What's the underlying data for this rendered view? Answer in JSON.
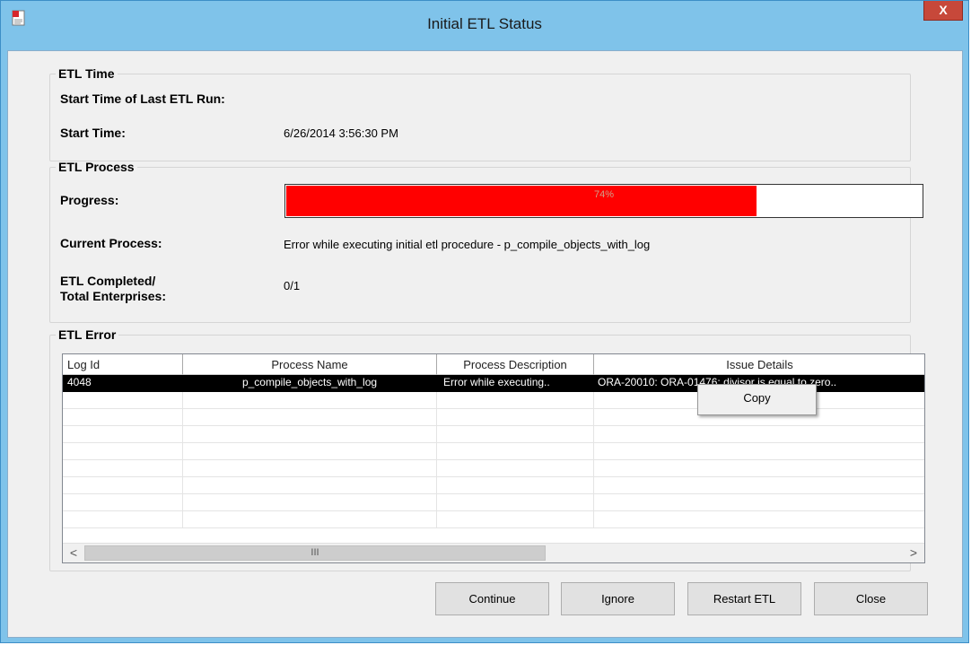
{
  "window": {
    "title": "Initial ETL Status",
    "close_label": "X"
  },
  "etl_time": {
    "legend": "ETL Time",
    "last_run_label": "Start Time of Last ETL Run:",
    "start_time_label": "Start Time:",
    "start_time_value": "6/26/2014 3:56:30 PM"
  },
  "etl_process": {
    "legend": "ETL Process",
    "progress_label": "Progress:",
    "progress_percent": 74,
    "progress_text": "74%",
    "current_process_label": "Current Process:",
    "current_process_value": "Error while executing initial etl procedure - p_compile_objects_with_log",
    "completed_label_line1": "ETL Completed/",
    "completed_label_line2": "Total Enterprises:",
    "completed_value": "0/1"
  },
  "etl_error": {
    "legend": "ETL Error",
    "columns": [
      "Log Id",
      "Process Name",
      "Process Description",
      "Issue Details"
    ],
    "rows": [
      {
        "log_id": "4048",
        "process_name": "p_compile_objects_with_log",
        "process_description": "Error while executing..",
        "issue_details": "ORA-20010: ORA-01476: divisor is equal to zero.."
      }
    ],
    "scroll_left": "<",
    "scroll_right": ">",
    "scroll_thumb": "III"
  },
  "context_menu": {
    "copy_label": "Copy"
  },
  "buttons": {
    "continue": "Continue",
    "ignore": "Ignore",
    "restart": "Restart ETL",
    "close": "Close"
  },
  "colors": {
    "progress_fill": "#ff0000",
    "titlebar": "#7fc3ea",
    "close_button": "#c7483a",
    "selected_row": "#000000"
  }
}
